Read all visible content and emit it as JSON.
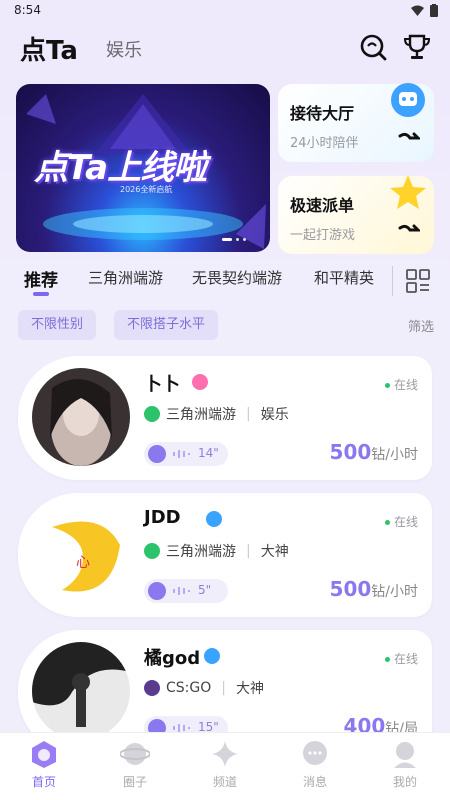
{
  "status": {
    "time": "8:54"
  },
  "header": {
    "brand": "点Ta",
    "nav_secondary": "娱乐"
  },
  "banner": {
    "title": "点Ta上线啦",
    "subtitle": "2026全新启航"
  },
  "side_cards": [
    {
      "title": "接待大厅",
      "subtitle": "24小时陪伴"
    },
    {
      "title": "极速派单",
      "subtitle": "一起打游戏"
    }
  ],
  "tabs": [
    "推荐",
    "三角洲端游",
    "无畏契约端游",
    "和平精英"
  ],
  "filters": {
    "chips": [
      "不限性别",
      "不限搭子水平"
    ],
    "link": "筛选"
  },
  "cards": [
    {
      "name": "卜卜",
      "status": "在线",
      "game": "三角洲端游",
      "tag": "娱乐",
      "voice": "14\"",
      "price": "500",
      "unit": "钻/小时"
    },
    {
      "name": "JDD",
      "status": "在线",
      "game": "三角洲端游",
      "tag": "大神",
      "voice": "5\"",
      "price": "500",
      "unit": "钻/小时"
    },
    {
      "name": "橘god",
      "status": "在线",
      "game": "CS:GO",
      "tag": "大神",
      "voice": "15\"",
      "price": "400",
      "unit": "钻/局"
    }
  ],
  "bottom_nav": [
    "首页",
    "圈子",
    "频道",
    "消息",
    "我的"
  ],
  "colors": {
    "accent": "#7c68f0",
    "online": "#2cc36b",
    "chip_bg": "#e4dff8"
  }
}
